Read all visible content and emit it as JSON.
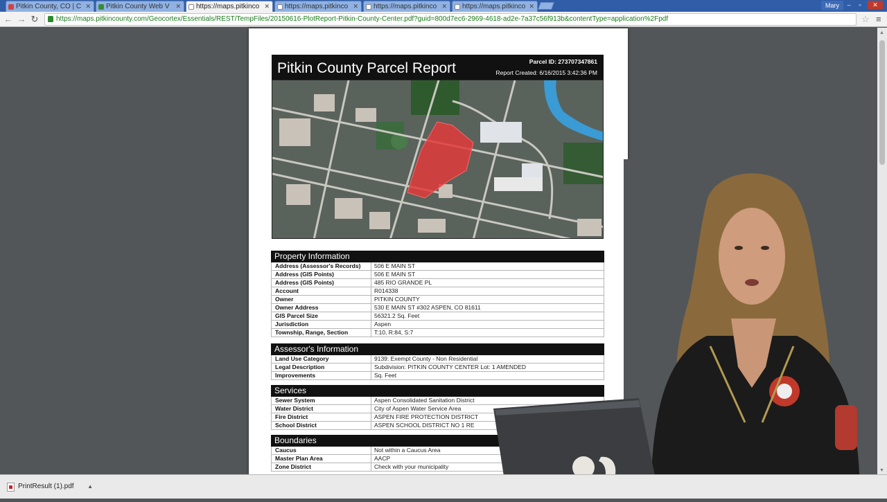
{
  "browser": {
    "tabs": [
      {
        "label": "Pitkin County, CO | C",
        "icon": "county-icon",
        "active": false
      },
      {
        "label": "Pitkin County Web V",
        "icon": "map-icon",
        "active": false
      },
      {
        "label": "https://maps.pitkinco",
        "icon": "document-icon",
        "active": true
      },
      {
        "label": "https://maps.pitkinco",
        "icon": "document-icon",
        "active": false
      },
      {
        "label": "https://maps.pitkinco",
        "icon": "document-icon",
        "active": false
      },
      {
        "label": "https://maps.pitkinco",
        "icon": "document-icon",
        "active": false
      }
    ],
    "user_label": "Mary",
    "url": "https://maps.pitkincounty.com/Geocortex/Essentials/REST/TempFiles/20150616-PlotReport-Pitkin-County-Center.pdf?guid=800d7ec6-2969-4618-ad2e-7a37c56f913b&contentType=application%2Fpdf"
  },
  "report": {
    "title": "Pitkin County Parcel Report",
    "parcel_id": "Parcel ID: 273707347861",
    "created": "Report Created: 6/16/2015 3:42:36 PM",
    "sections": [
      {
        "title": "Property Information",
        "rows": [
          {
            "k": "Address (Assessor's Records)",
            "v": "506 E MAIN ST"
          },
          {
            "k": "Address (GIS Points)",
            "v": "506 E MAIN ST"
          },
          {
            "k": "Address (GIS Points)",
            "v": "485 RIO GRANDE PL"
          },
          {
            "k": "Account",
            "v": "R014338"
          },
          {
            "k": "Owner",
            "v": "PITKIN COUNTY"
          },
          {
            "k": "Owner Address",
            "v": "530 E MAIN ST #302  ASPEN, CO 81611"
          },
          {
            "k": "GIS Parcel Size",
            "v": "56321.2 Sq. Feet"
          },
          {
            "k": "Jurisdiction",
            "v": "Aspen"
          },
          {
            "k": "Township, Range, Section",
            "v": "T:10, R:84, S:7"
          }
        ]
      },
      {
        "title": "Assessor's Information",
        "rows": [
          {
            "k": "Land Use Category",
            "v": "9139: Exempt County - Non Residential"
          },
          {
            "k": "Legal Description",
            "v": "Subdivision: PITKIN COUNTY CENTER Lot: 1  AMENDED"
          },
          {
            "k": "Improvements",
            "v": " Sq. Feet"
          }
        ]
      },
      {
        "title": "Services",
        "rows": [
          {
            "k": "Sewer System",
            "v": "Aspen Consolidated Sanitation District"
          },
          {
            "k": "Water District",
            "v": "City of Aspen Water Service Area"
          },
          {
            "k": "Fire District",
            "v": "ASPEN FIRE PROTECTION DISTRICT"
          },
          {
            "k": "School District",
            "v": "ASPEN SCHOOL DISTRICT NO 1 RE"
          }
        ]
      },
      {
        "title": "Boundaries",
        "rows": [
          {
            "k": "Caucus",
            "v": "Not within a Caucus Area"
          },
          {
            "k": "Master Plan Area",
            "v": "AACP"
          },
          {
            "k": "Zone District",
            "v": "Check with your municipality"
          }
        ]
      }
    ]
  },
  "downloads": [
    {
      "filename": "PrintResult (1).pdf",
      "icon": "pdf-icon"
    }
  ],
  "colors": {
    "tabstrip": "#2f5da8",
    "header_bar": "#111111",
    "parcel_highlight": "#e23b3b",
    "viewer_bg": "#525659"
  }
}
